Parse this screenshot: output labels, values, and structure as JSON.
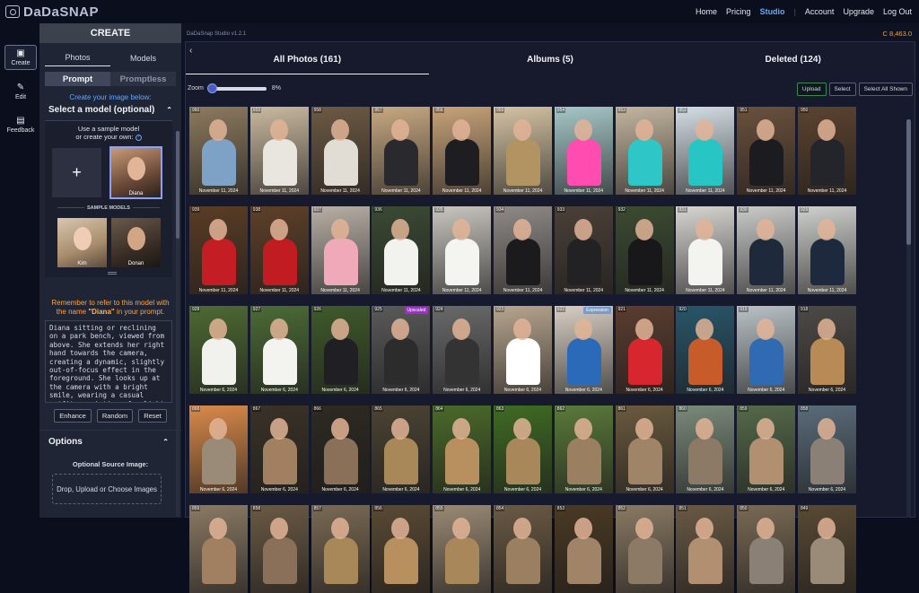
{
  "app": {
    "name": "DaDaSNAP",
    "version": "DaDaSnap Studio v1.2.1",
    "credits": "C 8,463.0"
  },
  "topnav": [
    "Home",
    "Pricing",
    "Studio",
    "|",
    "Account",
    "Upgrade",
    "Log Out"
  ],
  "leftbar": [
    {
      "label": "Create",
      "icon": "create-icon"
    },
    {
      "label": "Edit",
      "icon": "pencil-icon"
    },
    {
      "label": "Feedback",
      "icon": "chat-icon"
    }
  ],
  "panel": {
    "title": "CREATE",
    "tabs": [
      "Photos",
      "Models"
    ],
    "modes": [
      "Prompt",
      "Promptless"
    ],
    "hint": "Create your image below:",
    "model_select": "Select a model (optional)",
    "model_box_title_1": "Use a sample model",
    "model_box_title_2": "or create your own:",
    "plus": "+",
    "selected_model": "Diana",
    "sample_models_label": "SAMPLE MODELS",
    "samples": [
      "Kim",
      "Donan"
    ],
    "remember_1": "Remember to refer to this model with",
    "remember_2": "the name",
    "remember_name": "\"Diana\"",
    "remember_3": "in your prompt.",
    "prompt_text": "Diana sitting or reclining on a park bench, viewed from above. She extends her right hand towards the camera, creating a dynamic, slightly out-of-focus effect in the foreground. She looks up at the camera with a bright smile, wearing a casual outfit consisting of a light denim jacket and athletic",
    "buttons": [
      "Enhance",
      "Random",
      "Reset"
    ],
    "options_label": "Options",
    "source_label": "Optional Source Image:",
    "drop_label": "Drop, Upload or Choose Images"
  },
  "gallery": {
    "tabs": [
      "All Photos (161)",
      "Albums (5)",
      "Deleted (124)"
    ],
    "zoom_label": "Zoom",
    "zoom_value": "8%",
    "zoom_fraction": 0.08,
    "actions": [
      "Upload",
      "Select",
      "Select All Shown"
    ],
    "rows": [
      {
        "date": "November 11, 2024",
        "ids": [
          "960",
          "959",
          "958",
          "957",
          "956",
          "955",
          "954",
          "953",
          "952",
          "951",
          "950"
        ],
        "tones": [
          "#8b7a5e",
          "#c9b9a0",
          "#6c5a44",
          "#c6a982",
          "#c7a37a",
          "#d4c3a4",
          "#a6c7c8",
          "#c3b6a0",
          "#d3dee4",
          "#6a513c",
          "#5b4330"
        ],
        "bodies": [
          "#7ea1c6",
          "#e9e6e0",
          "#e2ddd4",
          "#2a2a2e",
          "#1e1e22",
          "#b29463",
          "#ff4cb0",
          "#2ec6c6",
          "#28c5c5",
          "#1c1c20",
          "#24252a"
        ]
      },
      {
        "date": "November 11, 2024",
        "ids": [
          "939",
          "938",
          "937",
          "936",
          "935",
          "934",
          "933",
          "932",
          "931",
          "930",
          "929"
        ],
        "tones": [
          "#5a3d26",
          "#5e4029",
          "#b8b0a6",
          "#3b4a34",
          "#c9c6c0",
          "#8f8a86",
          "#4a4038",
          "#3c4b32",
          "#d8d6d2",
          "#c9cbc8",
          "#cdd0cc"
        ],
        "bodies": [
          "#c41e24",
          "#c11c22",
          "#f0a9b8",
          "#f2f2ee",
          "#f4f4f0",
          "#1b1b1e",
          "#222225",
          "#18181b",
          "#f3f3f0",
          "#1e2a3c",
          "#1d2a3d"
        ]
      },
      {
        "date": "November 6, 2024",
        "ids": [
          "928",
          "927",
          "926",
          "925",
          "924",
          "923",
          "922",
          "921",
          "920",
          "919",
          "918"
        ],
        "tones": [
          "#4d6a33",
          "#4b6b36",
          "#3f5a2b",
          "#5a5a5a",
          "#6a6a6a",
          "#b7a68f",
          "#d7cfc4",
          "#5a3d30",
          "#28566a",
          "#b9c2c6",
          "#4d4a46"
        ],
        "bodies": [
          "#f1f1ee",
          "#f3f3ef",
          "#202024",
          "#2c2c2c",
          "#333333",
          "#ffffff",
          "#2a6ab8",
          "#d8262e",
          "#c85b2a",
          "#2f6ab3",
          "#b88a56"
        ],
        "tags": {
          "3": [
            "Upscaled",
            "#a02fc8"
          ],
          "6": [
            "Expression",
            "#7a9ac8"
          ]
        }
      },
      {
        "date": "November 6, 2024",
        "ids": [
          "868",
          "867",
          "866",
          "865",
          "864",
          "863",
          "862",
          "861",
          "860",
          "859",
          "858"
        ],
        "tones": [
          "#d98a4a",
          "#3a3228",
          "#2d2a22",
          "#4b4434",
          "#4a6a2a",
          "#3f6b24",
          "#5a7a3a",
          "#6a5a3e",
          "#7a8a7a",
          "#556a4a",
          "#5a6c7a"
        ],
        "bodies": [
          "#9a8a78",
          "#a08060",
          "#8a7058",
          "#a88858",
          "#b89060",
          "#a8885a",
          "#9a8060",
          "#a08468",
          "#8c7a66",
          "#b09070",
          "#8a8076"
        ]
      },
      {
        "date": "",
        "ids": [
          "859",
          "858",
          "857",
          "856",
          "855",
          "854",
          "853",
          "852",
          "851",
          "850",
          "849"
        ],
        "tones": [
          "#8a7a64",
          "#6a5a44",
          "#7a6a54",
          "#5a4a34",
          "#9a8a74",
          "#6a5a44",
          "#4a3a24",
          "#8a7a64",
          "#6a5a44",
          "#7a6a54",
          "#5a4a34"
        ],
        "bodies": [
          "#a08060",
          "#8a7058",
          "#a88858",
          "#b89060",
          "#a8885a",
          "#9a8060",
          "#a08468",
          "#8c7a66",
          "#b09070",
          "#8a8076",
          "#9a8a78"
        ]
      }
    ]
  }
}
